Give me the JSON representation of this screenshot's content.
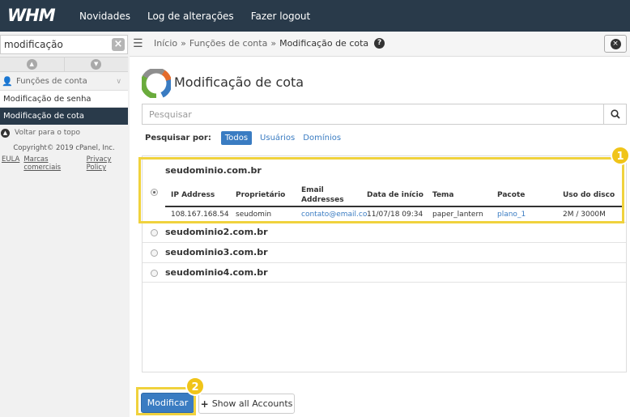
{
  "topbar": {
    "logo": "WHM",
    "nav": [
      "Novidades",
      "Log de alterações",
      "Fazer logout"
    ]
  },
  "sidebar": {
    "search_value": "modificação",
    "group_label": "Funções de conta",
    "items": [
      "Modificação de senha",
      "Modificação de cota"
    ],
    "back_to_top": "Voltar para o topo",
    "copyright": "Copyright© 2019 cPanel, Inc.",
    "legal": [
      "EULA",
      "Marcas comerciais",
      "Privacy Policy"
    ]
  },
  "breadcrumb": {
    "home": "Início",
    "section": "Funções de conta",
    "current": "Modificação de cota",
    "sep": "»"
  },
  "main": {
    "title": "Modificação de cota",
    "search_placeholder": "Pesquisar",
    "filter_label": "Pesquisar por:",
    "filters": [
      "Todos",
      "Usuários",
      "Domínios"
    ],
    "columns": [
      "IP Address",
      "Proprietário",
      "Email Addresses",
      "Data de início",
      "Tema",
      "Pacote",
      "Uso do disco"
    ],
    "selected_account": {
      "domain": "seudominio.com.br",
      "ip": "108.167.168.54",
      "owner": "seudomin",
      "email": "contato@email.co",
      "start_date": "11/07/18 09:34",
      "theme": "paper_lantern",
      "package": "plano_1",
      "disk": "2M / 3000M"
    },
    "other_accounts": [
      "seudominio2.com.br",
      "seudominio3.com.br",
      "seudominio4.com.br"
    ],
    "modify_button": "Modificar",
    "show_all_button": "Show all Accounts"
  },
  "annotations": [
    "1",
    "2"
  ],
  "colors": {
    "topbar": "#293a4a",
    "accent": "#3a7cc2",
    "highlight": "#f0d23d"
  }
}
